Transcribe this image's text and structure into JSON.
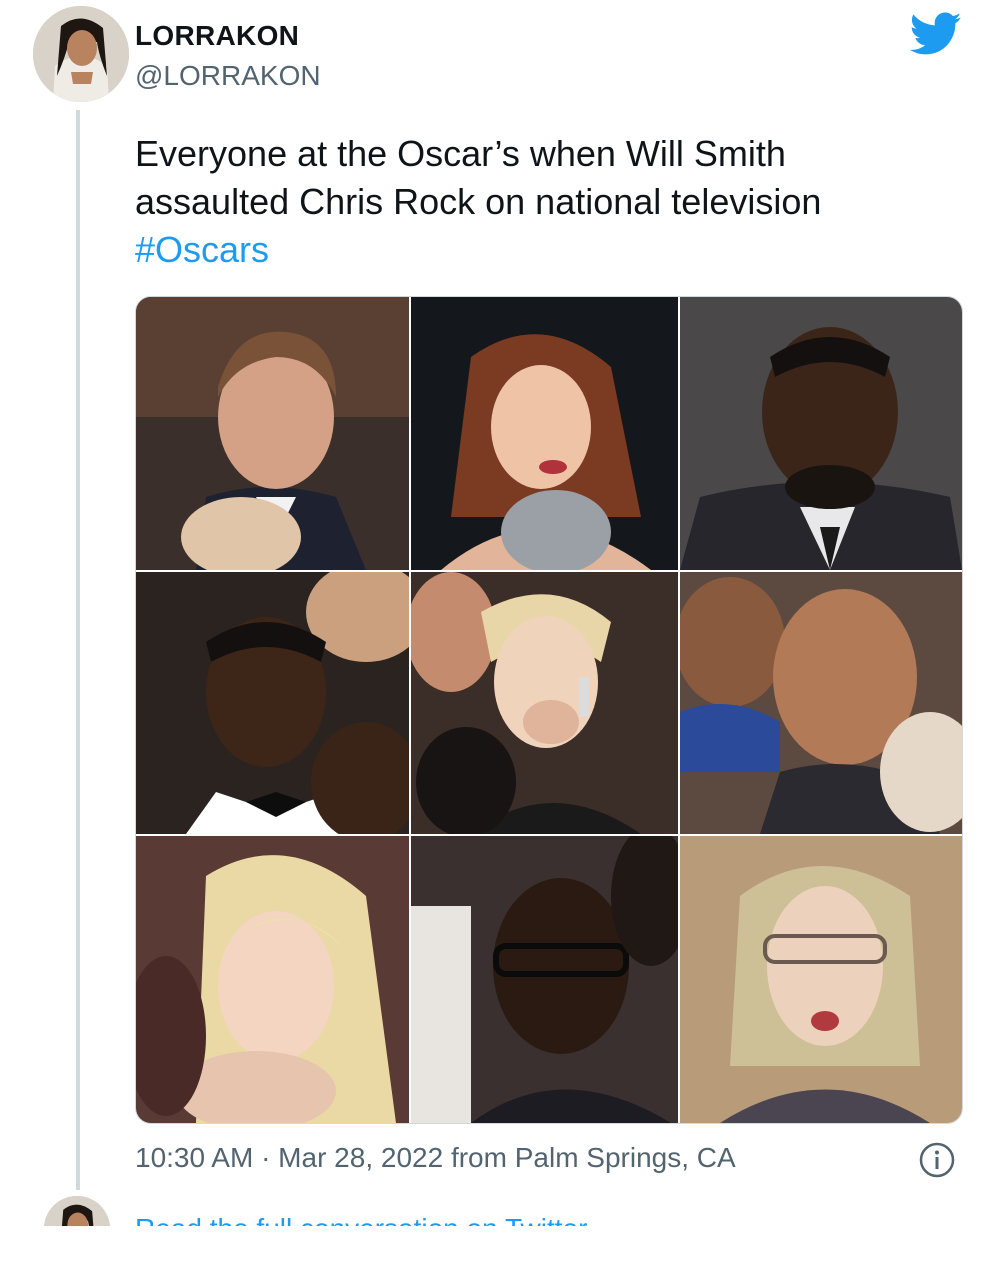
{
  "author": {
    "display_name": "LORRAKON",
    "handle": "@LORRAKON"
  },
  "icons": {
    "brand": "twitter-bird-icon",
    "info": "info-icon",
    "brand_color": "#1d9bf0"
  },
  "tweet": {
    "text": "Everyone at the Oscar’s when Will Smith assaulted Chris Rock on national television",
    "hashtag": "#Oscars"
  },
  "media": {
    "photo_count": 9
  },
  "meta": {
    "timestamp": "10:30 AM · Mar 28, 2022 from Palm Springs, CA"
  },
  "footer": {
    "cta": "Read the full conversation on Twitter"
  }
}
